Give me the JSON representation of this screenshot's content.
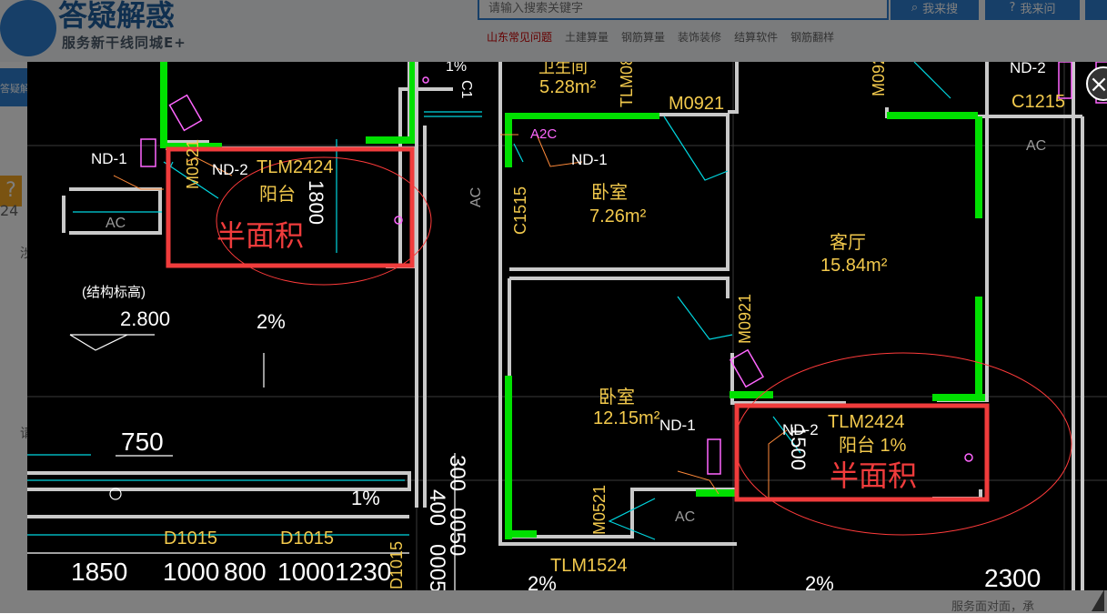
{
  "site": {
    "title": "答疑解惑",
    "subtitle": "服务新干线同城E+",
    "search_placeholder": "请输入搜索关键字",
    "btn_search": "我来搜",
    "btn_ask": "我来问",
    "hot_links": [
      "山东常见问题",
      "土建算量",
      "钢筋算量",
      "装饰装修",
      "结算软件",
      "钢筋翻样"
    ],
    "side_tab_label": "答疑解",
    "side_help_icon": "?",
    "side_fragment_num": "24",
    "side_fragment_char_1": "涉",
    "side_fragment_char_2": "请",
    "footer_text": "服务面对面，承",
    "close_icon": "×"
  },
  "drawing": {
    "labels": {
      "nd1_a": "ND-1",
      "nd2_a": "ND-2",
      "tlm2424_a": "TLM2424",
      "balcony_a": "阳台",
      "dim_1800": "1800",
      "m0521_a": "M0521",
      "half_area_a": "半面积",
      "ac_a": "AC",
      "struct_elev": "(结构标高)",
      "elev_2800": "2.800",
      "slope_2_a": "2%",
      "dim_750": "750",
      "slope_1_a": "1%",
      "d1015_a": "D1015",
      "d1015_b": "D1015",
      "d1015_c": "D1015",
      "dim_1850": "1850",
      "dim_1000_a": "1000",
      "dim_800": "800",
      "dim_1000_b": "1000",
      "dim_1230": "1230",
      "dim_300": "300",
      "dim_400": "400",
      "dim_0050": "0050",
      "dim_0005": "0005",
      "wc_area": "5.28m²",
      "wc_name": "卫生间",
      "tlm08": "TLM08",
      "c1_frag": "C1",
      "slope_1_frag": "1%",
      "m0921_a": "M0921",
      "a2c": "A2C",
      "nd1_b": "ND-1",
      "c1515": "C1515",
      "bedroom_a": "卧室",
      "bedroom_a_area": "7.26m²",
      "ac_b": "AC",
      "m0921_b": "M0921",
      "nd2_c": "ND-2",
      "c1215": "C1215",
      "ac_c": "AC",
      "living": "客厅",
      "living_area": "15.84m²",
      "m0921_c": "M0921",
      "bedroom_b": "卧室",
      "bedroom_b_area": "12.15m²",
      "nd1_c": "ND-1",
      "nd2_b": "ND-2",
      "tlm2424_b": "TLM2424",
      "balcony_b": "阳台 1%",
      "dim_1500": "1500",
      "half_area_b": "半面积",
      "m0521_b": "M0521",
      "ac_d": "AC",
      "tlm1524": "TLM1524",
      "slope_2_b": "2%",
      "slope_2_c": "2%",
      "dim_2300": "2300"
    }
  }
}
